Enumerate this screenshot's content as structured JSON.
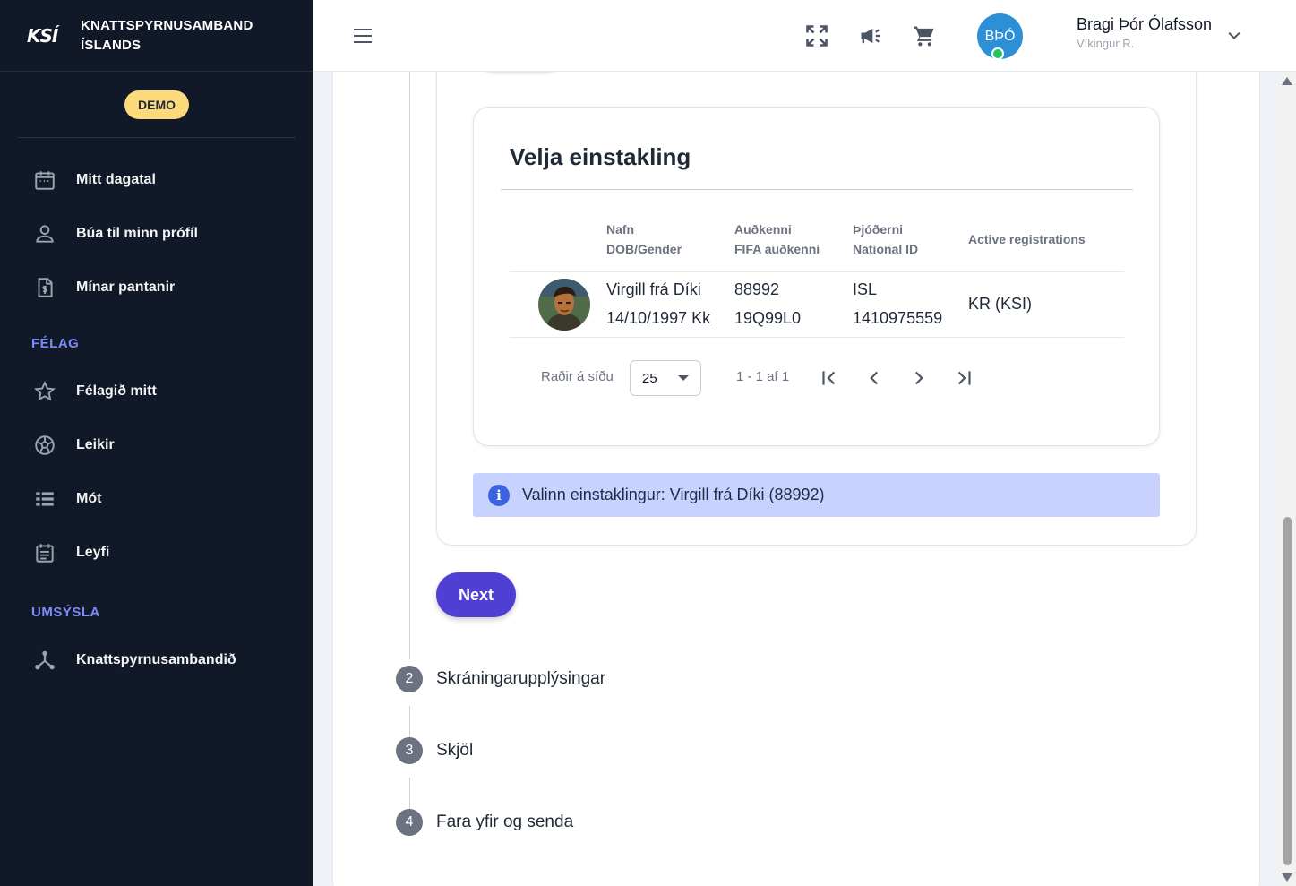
{
  "brand": {
    "logo": "KSÍ",
    "name_line1": "KNATTSPYRNUSAMBAND",
    "name_line2": "ÍSLANDS"
  },
  "badge": "DEMO",
  "sidebar": {
    "items": [
      {
        "label": "Mitt dagatal",
        "icon": "calendar-icon"
      },
      {
        "label": "Búa til minn prófíl",
        "icon": "person-icon"
      },
      {
        "label": "Mínar pantanir",
        "icon": "invoice-icon"
      }
    ],
    "section1": "FÉLAG",
    "club_items": [
      {
        "label": "Félagið mitt",
        "icon": "star-icon"
      },
      {
        "label": "Leikir",
        "icon": "soccer-ball-icon"
      },
      {
        "label": "Mót",
        "icon": "list-icon"
      },
      {
        "label": "Leyfi",
        "icon": "license-icon"
      }
    ],
    "section2": "UMSÝSLA",
    "admin_items": [
      {
        "label": "Knattspyrnusambandið",
        "icon": "hub-icon"
      }
    ]
  },
  "topbar": {
    "icons": [
      "menu-icon",
      "fullscreen-icon",
      "megaphone-icon",
      "cart-icon"
    ],
    "avatar_initials": "BÞÓ",
    "user_name": "Bragi Þór Ólafsson",
    "user_club": "Víkingur R."
  },
  "select_person": {
    "title": "Velja einstakling",
    "headers": {
      "col1_line1": "Nafn",
      "col1_line2": "DOB/Gender",
      "col2_line1": "Auðkenni",
      "col2_line2": "FIFA auðkenni",
      "col3_line1": "Þjóðerni",
      "col3_line2": "National ID",
      "col4": "Active registrations"
    },
    "row": {
      "name": "Virgill frá Díki",
      "dob_gender": "14/10/1997 Kk",
      "id": "88992",
      "fifa_id": "19Q99L0",
      "nationality": "ISL",
      "national_id": "1410975559",
      "registrations": "KR (KSI)"
    },
    "pager": {
      "rows_label": "Raðir á síðu",
      "rows_value": "25",
      "range": "1 - 1 af 1"
    }
  },
  "info": {
    "text": "Valinn einstaklingur: Virgill frá Díki (88992)",
    "icon": "info-icon"
  },
  "next_button": "Next",
  "steps": [
    {
      "num": "2",
      "label": "Skráningarupplýsingar"
    },
    {
      "num": "3",
      "label": "Skjöl"
    },
    {
      "num": "4",
      "label": "Fara yfir og senda"
    }
  ]
}
